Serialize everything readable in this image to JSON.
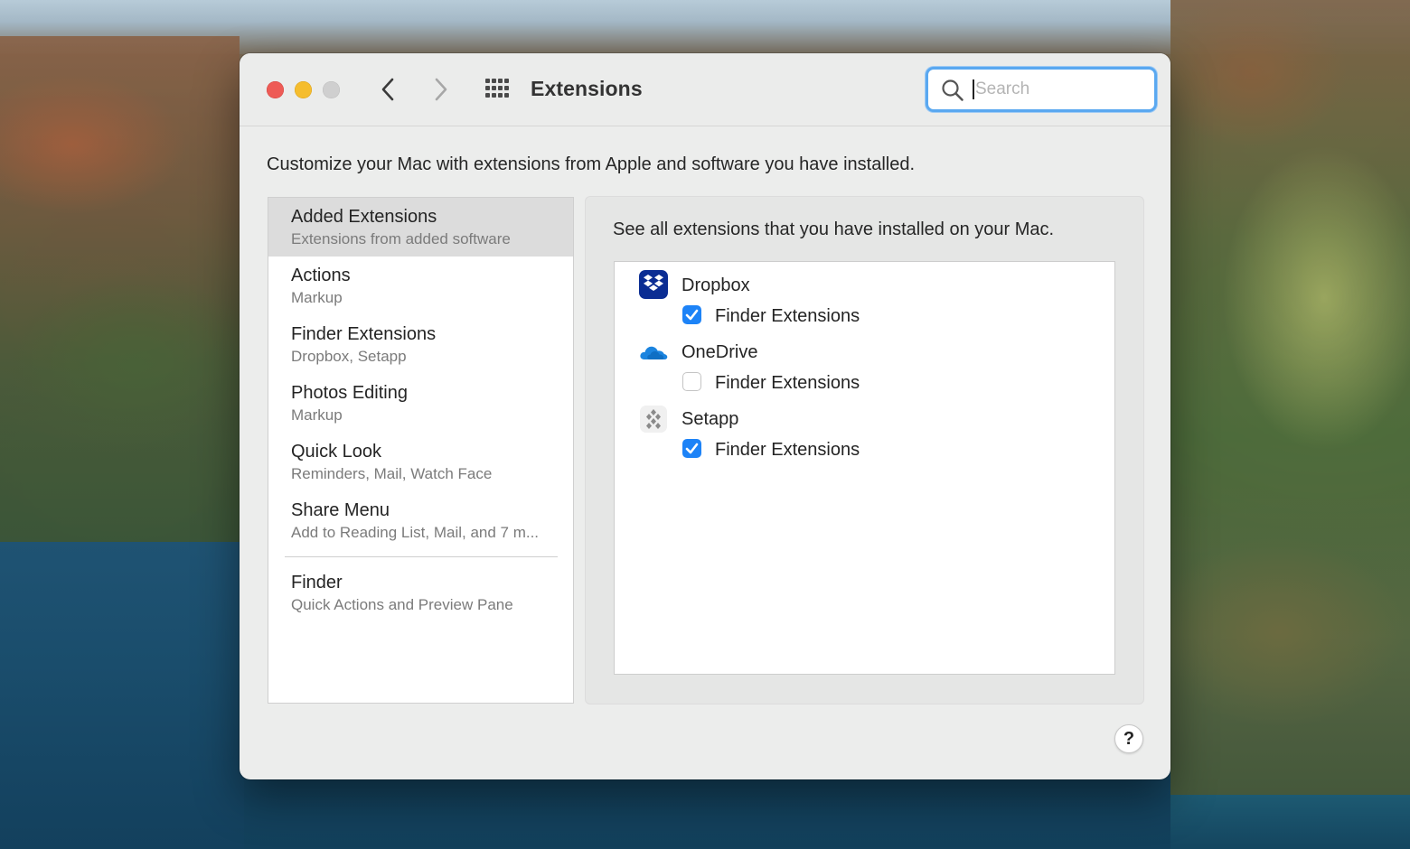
{
  "window": {
    "title": "Extensions",
    "search": {
      "placeholder": "Search",
      "value": ""
    },
    "intro": "Customize your Mac with extensions from Apple and software you have installed.",
    "help_label": "?"
  },
  "sidebar": {
    "items": [
      {
        "title": "Added Extensions",
        "subtitle": "Extensions from added software",
        "selected": true
      },
      {
        "title": "Actions",
        "subtitle": "Markup"
      },
      {
        "title": "Finder Extensions",
        "subtitle": "Dropbox, Setapp"
      },
      {
        "title": "Photos Editing",
        "subtitle": "Markup"
      },
      {
        "title": "Quick Look",
        "subtitle": "Reminders, Mail, Watch Face"
      },
      {
        "title": "Share Menu",
        "subtitle": "Add to Reading List, Mail, and 7 m..."
      },
      {
        "title": "Finder",
        "subtitle": "Quick Actions and Preview Pane"
      }
    ]
  },
  "detail": {
    "description": "See all extensions that you have installed on your Mac.",
    "apps": [
      {
        "name": "Dropbox",
        "icon": "dropbox-icon",
        "extension": "Finder Extensions",
        "checked": true
      },
      {
        "name": "OneDrive",
        "icon": "onedrive-icon",
        "extension": "Finder Extensions",
        "checked": false
      },
      {
        "name": "Setapp",
        "icon": "setapp-icon",
        "extension": "Finder Extensions",
        "checked": true
      }
    ]
  },
  "colors": {
    "accent": "#1d83f7",
    "close": "#ee5b56",
    "minimize": "#f5bd2e",
    "zoom_disabled": "#cfcfcf",
    "selected_row": "#dcdcdc"
  }
}
